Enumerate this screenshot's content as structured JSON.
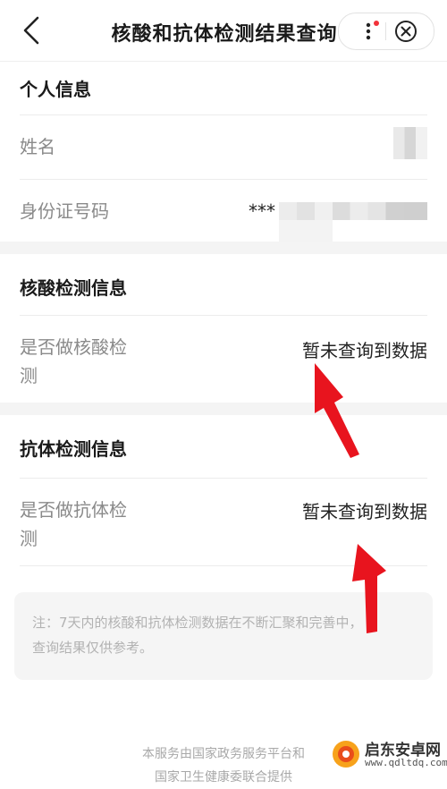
{
  "nav": {
    "title": "核酸和抗体检测结果查询"
  },
  "personal": {
    "title": "个人信息",
    "name_label": "姓名",
    "id_label": "身份证号码",
    "id_value_prefix": "***"
  },
  "nucleic": {
    "title": "核酸检测信息",
    "row_label_line1": "是否做核酸检",
    "row_label_line2": "测",
    "row_value": "暂未查询到数据"
  },
  "antibody": {
    "title": "抗体检测信息",
    "row_label_line1": "是否做抗体检",
    "row_label_line2": "测",
    "row_value": "暂未查询到数据"
  },
  "note": {
    "line1": "注：7天内的核酸和抗体检测数据在不断汇聚和完善中，",
    "line2": "查询结果仅供参考。"
  },
  "footer": {
    "line1": "本服务由国家政务服务平台和",
    "line2": "国家卫生健康委联合提供"
  },
  "watermark": {
    "name": "启东安卓网",
    "url": "www.qdltdq.com"
  },
  "colors": {
    "arrow": "#e8141e",
    "note_bg": "#f5f5f5",
    "section_gap": "#f4f4f4",
    "label": "#8a8a8a"
  },
  "icons": [
    "back-arrow-icon",
    "more-dots-icon",
    "close-circle-icon"
  ]
}
